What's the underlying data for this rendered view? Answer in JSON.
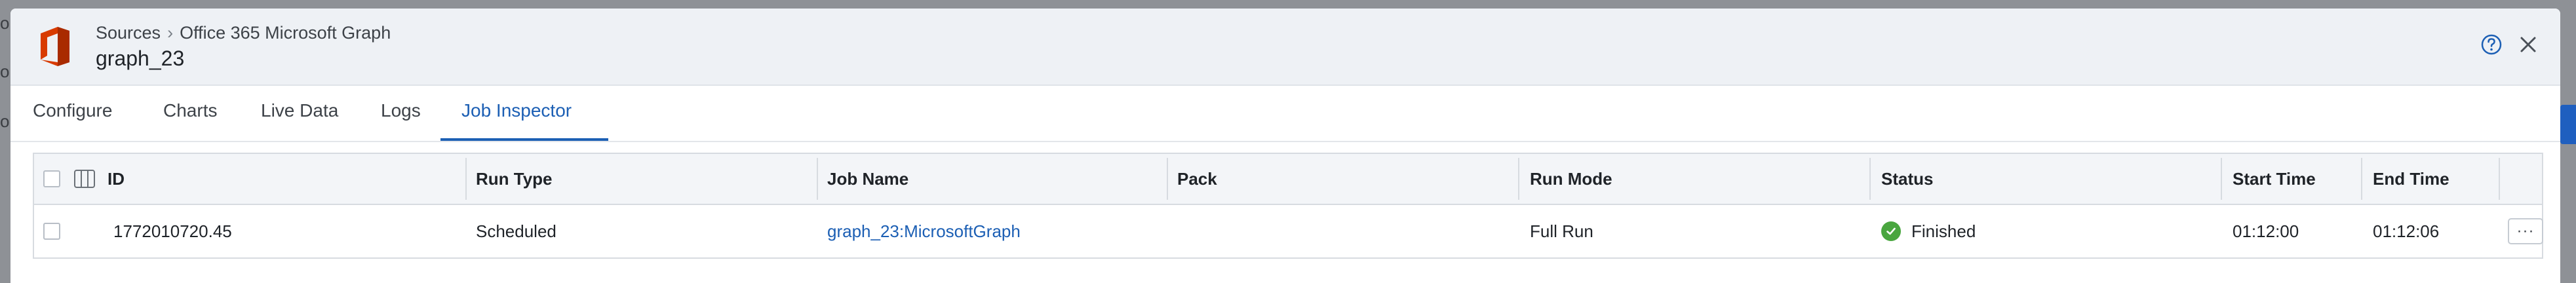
{
  "backdrop": {
    "text_fragments": [
      "o",
      "o",
      "o"
    ]
  },
  "header": {
    "logo_icon": "office-logo-icon",
    "breadcrumb": {
      "root": "Sources",
      "separator": "›",
      "current": "Office 365 Microsoft Graph"
    },
    "title": "graph_23",
    "help_icon": "help-circle-icon",
    "close_icon": "close-icon"
  },
  "tabs": [
    {
      "label": "Configure",
      "active": false
    },
    {
      "label": "Charts",
      "active": false
    },
    {
      "label": "Live Data",
      "active": false
    },
    {
      "label": "Logs",
      "active": false
    },
    {
      "label": "Job Inspector",
      "active": true
    }
  ],
  "table": {
    "columns": [
      "ID",
      "Run Type",
      "Job Name",
      "Pack",
      "Run Mode",
      "Status",
      "Start Time",
      "End Time"
    ],
    "rows": [
      {
        "id": "1772010720.45",
        "run_type": "Scheduled",
        "job_name": "graph_23:MicrosoftGraph",
        "pack": "",
        "run_mode": "Full Run",
        "status": "Finished",
        "start_time": "01:12:00",
        "end_time": "01:12:06",
        "actions_label": "···"
      }
    ]
  },
  "colors": {
    "accent": "#1c5fb4",
    "success": "#49a63f",
    "header_bg": "#eef1f5"
  }
}
